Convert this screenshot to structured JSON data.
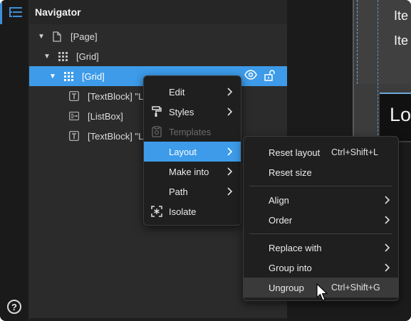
{
  "navigator": {
    "title": "Navigator",
    "tree": [
      {
        "label": "[Page]",
        "icon": "page-icon",
        "expanded": true
      },
      {
        "label": "[Grid]",
        "icon": "grid-icon",
        "expanded": true
      },
      {
        "label": "[Grid]",
        "icon": "grid-icon",
        "expanded": true,
        "selected": true
      },
      {
        "label": "[TextBlock] \"L",
        "icon": "textblock-icon"
      },
      {
        "label": "[ListBox]",
        "icon": "listbox-icon"
      },
      {
        "label": "[TextBlock] \"L",
        "icon": "textblock-icon"
      }
    ]
  },
  "canvas": {
    "item1": "Ite",
    "item2": "Ite",
    "lo": "Lo"
  },
  "context_menu": {
    "items": [
      {
        "label": "Edit",
        "submenu": true
      },
      {
        "label": "Styles",
        "icon": "paint-roller-icon",
        "submenu": true
      },
      {
        "label": "Templates",
        "icon": "templates-icon",
        "disabled": true
      },
      {
        "label": "Layout",
        "submenu": true,
        "highlighted": true
      },
      {
        "label": "Make into",
        "submenu": true
      },
      {
        "label": "Path",
        "submenu": true
      },
      {
        "label": "Isolate",
        "icon": "isolate-icon"
      }
    ]
  },
  "layout_submenu": {
    "items": [
      {
        "label": "Reset layout",
        "shortcut": "Ctrl+Shift+L"
      },
      {
        "label": "Reset size"
      },
      {
        "label": "Align",
        "submenu": true
      },
      {
        "label": "Order",
        "submenu": true
      },
      {
        "label": "Replace with",
        "submenu": true
      },
      {
        "label": "Group into",
        "submenu": true
      },
      {
        "label": "Ungroup",
        "shortcut": "Ctrl+Shift+G",
        "hovered": true
      }
    ]
  },
  "colors": {
    "accent": "#3d9be9",
    "panel": "#2b2b2b",
    "menu_bg": "#1f1f1f"
  }
}
